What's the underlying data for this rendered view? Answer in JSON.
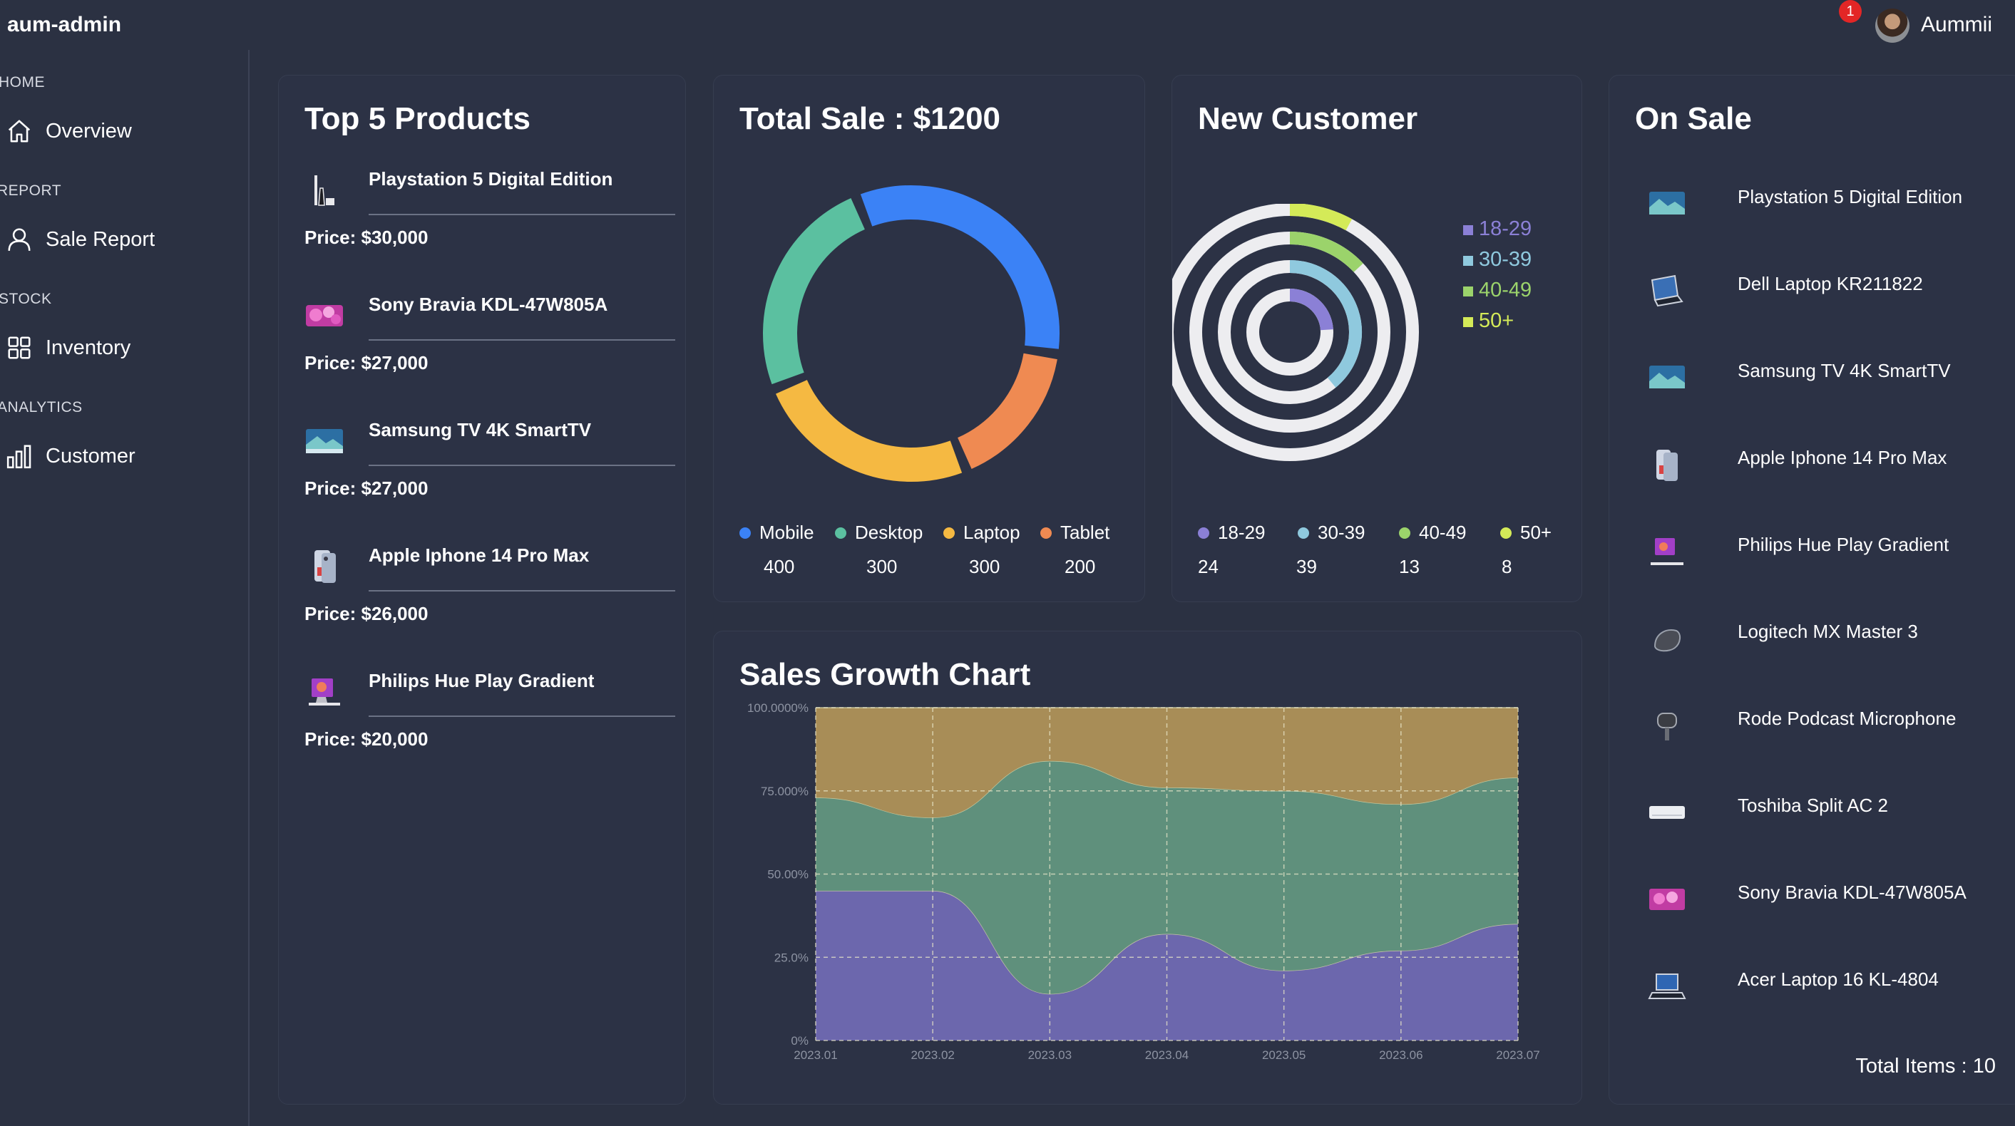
{
  "app": {
    "title": "aum-admin"
  },
  "header": {
    "notification_count": "1",
    "username": "Aummii"
  },
  "sidebar": {
    "sections": [
      {
        "label": "HOME",
        "item": "Overview",
        "icon": "home-icon"
      },
      {
        "label": "REPORT",
        "item": "Sale Report",
        "icon": "user-icon"
      },
      {
        "label": "STOCK",
        "item": "Inventory",
        "icon": "grid-icon"
      },
      {
        "label": "ANALYTICS",
        "item": "Customer",
        "icon": "bar-chart-icon"
      }
    ]
  },
  "top_products": {
    "title": "Top 5 Products",
    "items": [
      {
        "name": "Playstation 5 Digital Edition",
        "price": "Price: $30,000"
      },
      {
        "name": "Sony Bravia KDL-47W805A",
        "price": "Price: $27,000"
      },
      {
        "name": "Samsung TV 4K SmartTV",
        "price": "Price: $27,000"
      },
      {
        "name": "Apple Iphone 14 Pro Max",
        "price": "Price: $26,000"
      },
      {
        "name": "Philips Hue Play Gradient",
        "price": "Price: $20,000"
      }
    ]
  },
  "total_sale": {
    "title": "Total Sale : $1200",
    "legend": [
      {
        "label": "Mobile",
        "value": "400",
        "color": "#3b82f6"
      },
      {
        "label": "Desktop",
        "value": "300",
        "color": "#5bc0a0"
      },
      {
        "label": "Laptop",
        "value": "300",
        "color": "#f5b942"
      },
      {
        "label": "Tablet",
        "value": "200",
        "color": "#ef8a52"
      }
    ]
  },
  "new_customer": {
    "title": "New Customer",
    "legend": [
      {
        "label": "18-29",
        "value": "24",
        "color": "#8b80d6"
      },
      {
        "label": "30-39",
        "value": "39",
        "color": "#8fc9de"
      },
      {
        "label": "40-49",
        "value": "13",
        "color": "#9bd36b"
      },
      {
        "label": "50+",
        "value": "8",
        "color": "#d4ea58"
      }
    ]
  },
  "sales_growth": {
    "title": "Sales Growth Chart"
  },
  "on_sale": {
    "title": "On Sale",
    "items": [
      "Playstation 5 Digital Edition",
      "Dell Laptop KR211822",
      "Samsung TV 4K SmartTV",
      "Apple Iphone 14 Pro Max",
      "Philips Hue Play Gradient",
      "Logitech MX Master 3",
      "Rode Podcast Microphone",
      "Toshiba Split AC 2",
      "Sony Bravia KDL-47W805A",
      "Acer Laptop 16 KL-4804"
    ],
    "total": "Total Items : 10"
  },
  "chart_data": [
    {
      "type": "pie",
      "title": "Total Sale : $1200",
      "categories": [
        "Mobile",
        "Desktop",
        "Laptop",
        "Tablet"
      ],
      "values": [
        400,
        300,
        300,
        200
      ],
      "colors": [
        "#3b82f6",
        "#f5b942",
        "#ef8a52",
        "#5bc0a0"
      ]
    },
    {
      "type": "radial-bar",
      "title": "New Customer",
      "categories": [
        "18-29",
        "30-39",
        "40-49",
        "50+"
      ],
      "values": [
        24,
        39,
        13,
        8
      ],
      "max": 100,
      "colors": [
        "#8b80d6",
        "#8fc9de",
        "#9bd36b",
        "#d4ea58"
      ]
    },
    {
      "type": "area",
      "stacked": "100%",
      "title": "Sales Growth Chart",
      "x": [
        "2023.01",
        "2023.02",
        "2023.03",
        "2023.04",
        "2023.05",
        "2023.06",
        "2023.07"
      ],
      "yticks": [
        "0%",
        "25.0%",
        "50.00%",
        "75.000%",
        "100.0000%"
      ],
      "ylim": [
        0,
        100
      ],
      "series": [
        {
          "values": [
            45,
            45,
            14,
            32,
            21,
            27,
            35
          ],
          "color": "#6c67ad"
        },
        {
          "values": [
            28,
            22,
            70,
            44,
            54,
            44,
            44
          ],
          "color": "#5f907c"
        },
        {
          "values": [
            27,
            33,
            16,
            24,
            25,
            29,
            21
          ],
          "color": "#a88d57"
        }
      ],
      "grid": true
    }
  ]
}
